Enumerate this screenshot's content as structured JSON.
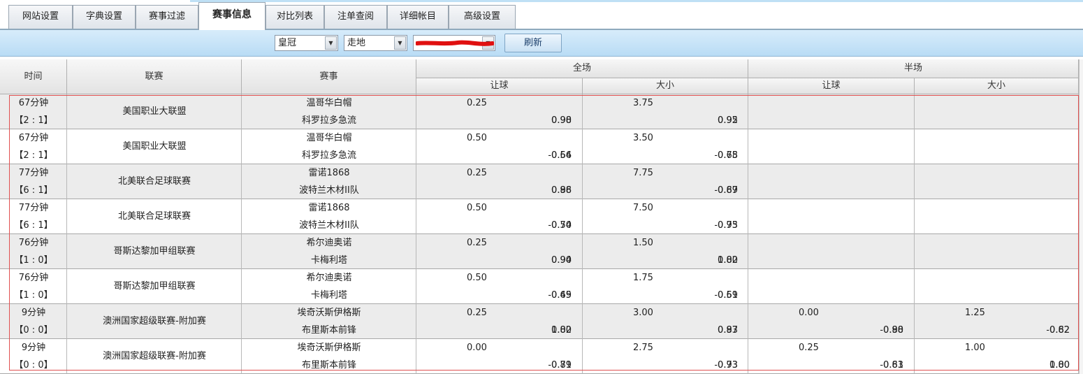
{
  "tabs": [
    {
      "label": "网站设置"
    },
    {
      "label": "字典设置"
    },
    {
      "label": "赛事过滤"
    },
    {
      "label": "赛事信息"
    },
    {
      "label": "对比列表"
    },
    {
      "label": "注单查阅"
    },
    {
      "label": "详细帐目"
    },
    {
      "label": "高级设置"
    }
  ],
  "toolbar": {
    "site_select": "皇冠",
    "mode_select": "走地",
    "refresh_label": "刷新"
  },
  "headers": {
    "time": "时间",
    "league": "联赛",
    "match": "赛事",
    "full": "全场",
    "half": "半场",
    "handicap": "让球",
    "overunder": "大小"
  },
  "rows": [
    {
      "time": "67分钟",
      "score": "【2 : 1】",
      "league": "美国职业大联盟",
      "home": "温哥华白帽",
      "away": "科罗拉多急流",
      "full_hdp": "0.25",
      "full_hdp_o1": "0.98",
      "full_hdp_o2": "0.90",
      "full_ou": "3.75",
      "full_ou_o1": "0.95",
      "full_ou_o2": "0.92",
      "half_hdp": "",
      "half_hdp_o1": "",
      "half_hdp_o2": "",
      "half_ou": "",
      "half_ou_o1": "",
      "half_ou_o2": ""
    },
    {
      "time": "67分钟",
      "score": "【2 : 1】",
      "league": "美国职业大联盟",
      "home": "温哥华白帽",
      "away": "科罗拉多急流",
      "full_hdp": "0.50",
      "full_hdp_o1": "-0.66",
      "full_hdp_o2": "0.54",
      "full_ou": "3.50",
      "full_ou_o1": "0.65",
      "full_ou_o2": "-0.78",
      "half_hdp": "",
      "half_hdp_o1": "",
      "half_hdp_o2": "",
      "half_ou": "",
      "half_ou_o1": "",
      "half_ou_o2": ""
    },
    {
      "time": "77分钟",
      "score": "【6 : 1】",
      "league": "北美联合足球联赛",
      "home": "雷诺1868",
      "away": "波特兰木材II队",
      "full_hdp": "0.25",
      "full_hdp_o1": "0.88",
      "full_hdp_o2": "0.96",
      "full_ou": "7.75",
      "full_ou_o1": "-0.87",
      "full_ou_o2": "0.69",
      "half_hdp": "",
      "half_hdp_o1": "",
      "half_hdp_o2": "",
      "half_ou": "",
      "half_ou_o1": "",
      "half_ou_o2": ""
    },
    {
      "time": "77分钟",
      "score": "【6 : 1】",
      "league": "北美联合足球联赛",
      "home": "雷诺1868",
      "away": "波特兰木材II队",
      "full_hdp": "0.50",
      "full_hdp_o1": "-0.70",
      "full_hdp_o2": "0.54",
      "full_ou": "7.50",
      "full_ou_o1": "0.75",
      "full_ou_o2": "-0.93",
      "half_hdp": "",
      "half_hdp_o1": "",
      "half_hdp_o2": "",
      "half_ou": "",
      "half_ou_o1": "",
      "half_ou_o2": ""
    },
    {
      "time": "76分钟",
      "score": "【1 : 0】",
      "league": "哥斯达黎加甲组联赛",
      "home": "希尔迪奥诺",
      "away": "卡梅利塔",
      "full_hdp": "0.25",
      "full_hdp_o1": "0.94",
      "full_hdp_o2": "0.90",
      "full_ou": "1.50",
      "full_ou_o1": "1.00",
      "full_ou_o2": "0.82",
      "half_hdp": "",
      "half_hdp_o1": "",
      "half_hdp_o2": "",
      "half_ou": "",
      "half_ou_o1": "",
      "half_ou_o2": ""
    },
    {
      "time": "76分钟",
      "score": "【1 : 0】",
      "league": "哥斯达黎加甲组联赛",
      "home": "希尔迪奥诺",
      "away": "卡梅利塔",
      "full_hdp": "0.50",
      "full_hdp_o1": "-0.65",
      "full_hdp_o2": "0.49",
      "full_ou": "1.75",
      "full_ou_o1": "-0.69",
      "full_ou_o2": "0.51",
      "half_hdp": "",
      "half_hdp_o1": "",
      "half_hdp_o2": "",
      "half_ou": "",
      "half_ou_o1": "",
      "half_ou_o2": ""
    },
    {
      "time": "9分钟",
      "score": "【0 : 0】",
      "league": "澳洲国家超级联赛-附加赛",
      "home": "埃奇沃斯伊格斯",
      "away": "布里斯本前锋",
      "full_hdp": "0.25",
      "full_hdp_o1": "1.00",
      "full_hdp_o2": "0.82",
      "full_ou": "3.00",
      "full_ou_o1": "0.97",
      "full_ou_o2": "0.83",
      "half_hdp": "0.00",
      "half_hdp_o1": "0.80",
      "half_hdp_o2": "-0.98",
      "half_ou": "1.25",
      "half_ou_o1": "-0.82",
      "half_ou_o2": "0.62"
    },
    {
      "time": "9分钟",
      "score": "【0 : 0】",
      "league": "澳洲国家超级联赛-附加赛",
      "home": "埃奇沃斯伊格斯",
      "away": "布里斯本前锋",
      "full_hdp": "0.00",
      "full_hdp_o1": "0.71",
      "full_hdp_o2": "-0.89",
      "full_ou": "2.75",
      "full_ou_o1": "0.73",
      "full_ou_o2": "-0.93",
      "half_hdp": "0.25",
      "half_hdp_o1": "-0.81",
      "half_hdp_o2": "0.63",
      "half_ou": "1.00",
      "half_ou_o1": "0.80",
      "half_ou_o2": "1.00"
    }
  ]
}
